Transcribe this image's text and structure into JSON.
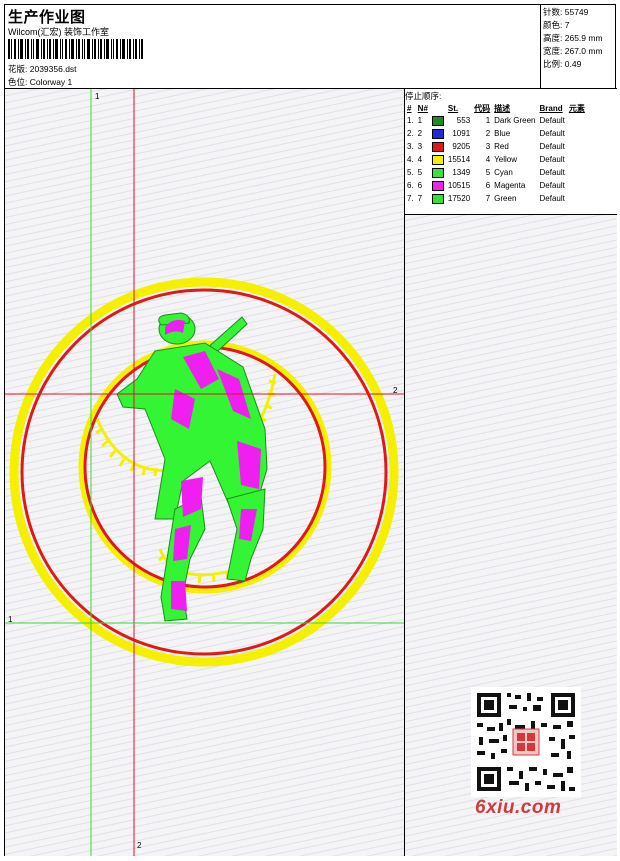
{
  "header": {
    "title": "生产作业图",
    "subtitle": "Wilcom(汇宏) 装饰工作室",
    "design_label": "花版:",
    "design_value": "2039356.dst",
    "colorway_label": "色位:",
    "colorway_value": "Colorway 1"
  },
  "stats": [
    {
      "label": "针数:",
      "value": "55749"
    },
    {
      "label": "颜色:",
      "value": "7"
    },
    {
      "label": "高度:",
      "value": "265.9 mm"
    },
    {
      "label": "宽度:",
      "value": "267.0 mm"
    },
    {
      "label": "比例:",
      "value": "0.49"
    }
  ],
  "stop_sequence": {
    "title": "停止顺序:",
    "headers": [
      "#",
      "N#",
      "",
      "St.",
      "代码",
      "描述",
      "Brand",
      "元素"
    ],
    "rows": [
      {
        "idx": "1.",
        "n": "1",
        "color": "#1e8c1e",
        "stitches": "553",
        "code": "1",
        "desc": "Dark Green",
        "brand": "Default"
      },
      {
        "idx": "2.",
        "n": "2",
        "color": "#1f2bd8",
        "stitches": "1091",
        "code": "2",
        "desc": "Blue",
        "brand": "Default"
      },
      {
        "idx": "3.",
        "n": "3",
        "color": "#e01818",
        "stitches": "9205",
        "code": "3",
        "desc": "Red",
        "brand": "Default"
      },
      {
        "idx": "4.",
        "n": "4",
        "color": "#f5f000",
        "stitches": "15514",
        "code": "4",
        "desc": "Yellow",
        "brand": "Default"
      },
      {
        "idx": "5.",
        "n": "5",
        "color": "#3be23b",
        "stitches": "1349",
        "code": "5",
        "desc": "Cyan",
        "brand": "Default"
      },
      {
        "idx": "6.",
        "n": "6",
        "color": "#ee22ee",
        "stitches": "10515",
        "code": "6",
        "desc": "Magenta",
        "brand": "Default"
      },
      {
        "idx": "7.",
        "n": "7",
        "color": "#2fe32f",
        "stitches": "17520",
        "code": "7",
        "desc": "Green",
        "brand": "Default"
      }
    ]
  },
  "guides": {
    "v1": "1",
    "v2": "2",
    "h1": "1",
    "h2": "2"
  },
  "watermark": "6xiu.com",
  "colors": {
    "guide_green": "#33dd33",
    "guide_red": "#e0102a",
    "ring_yellow": "#f5f000",
    "ring_red": "#e01818",
    "figure_green": "#33f533",
    "figure_magenta": "#f01ef0"
  }
}
